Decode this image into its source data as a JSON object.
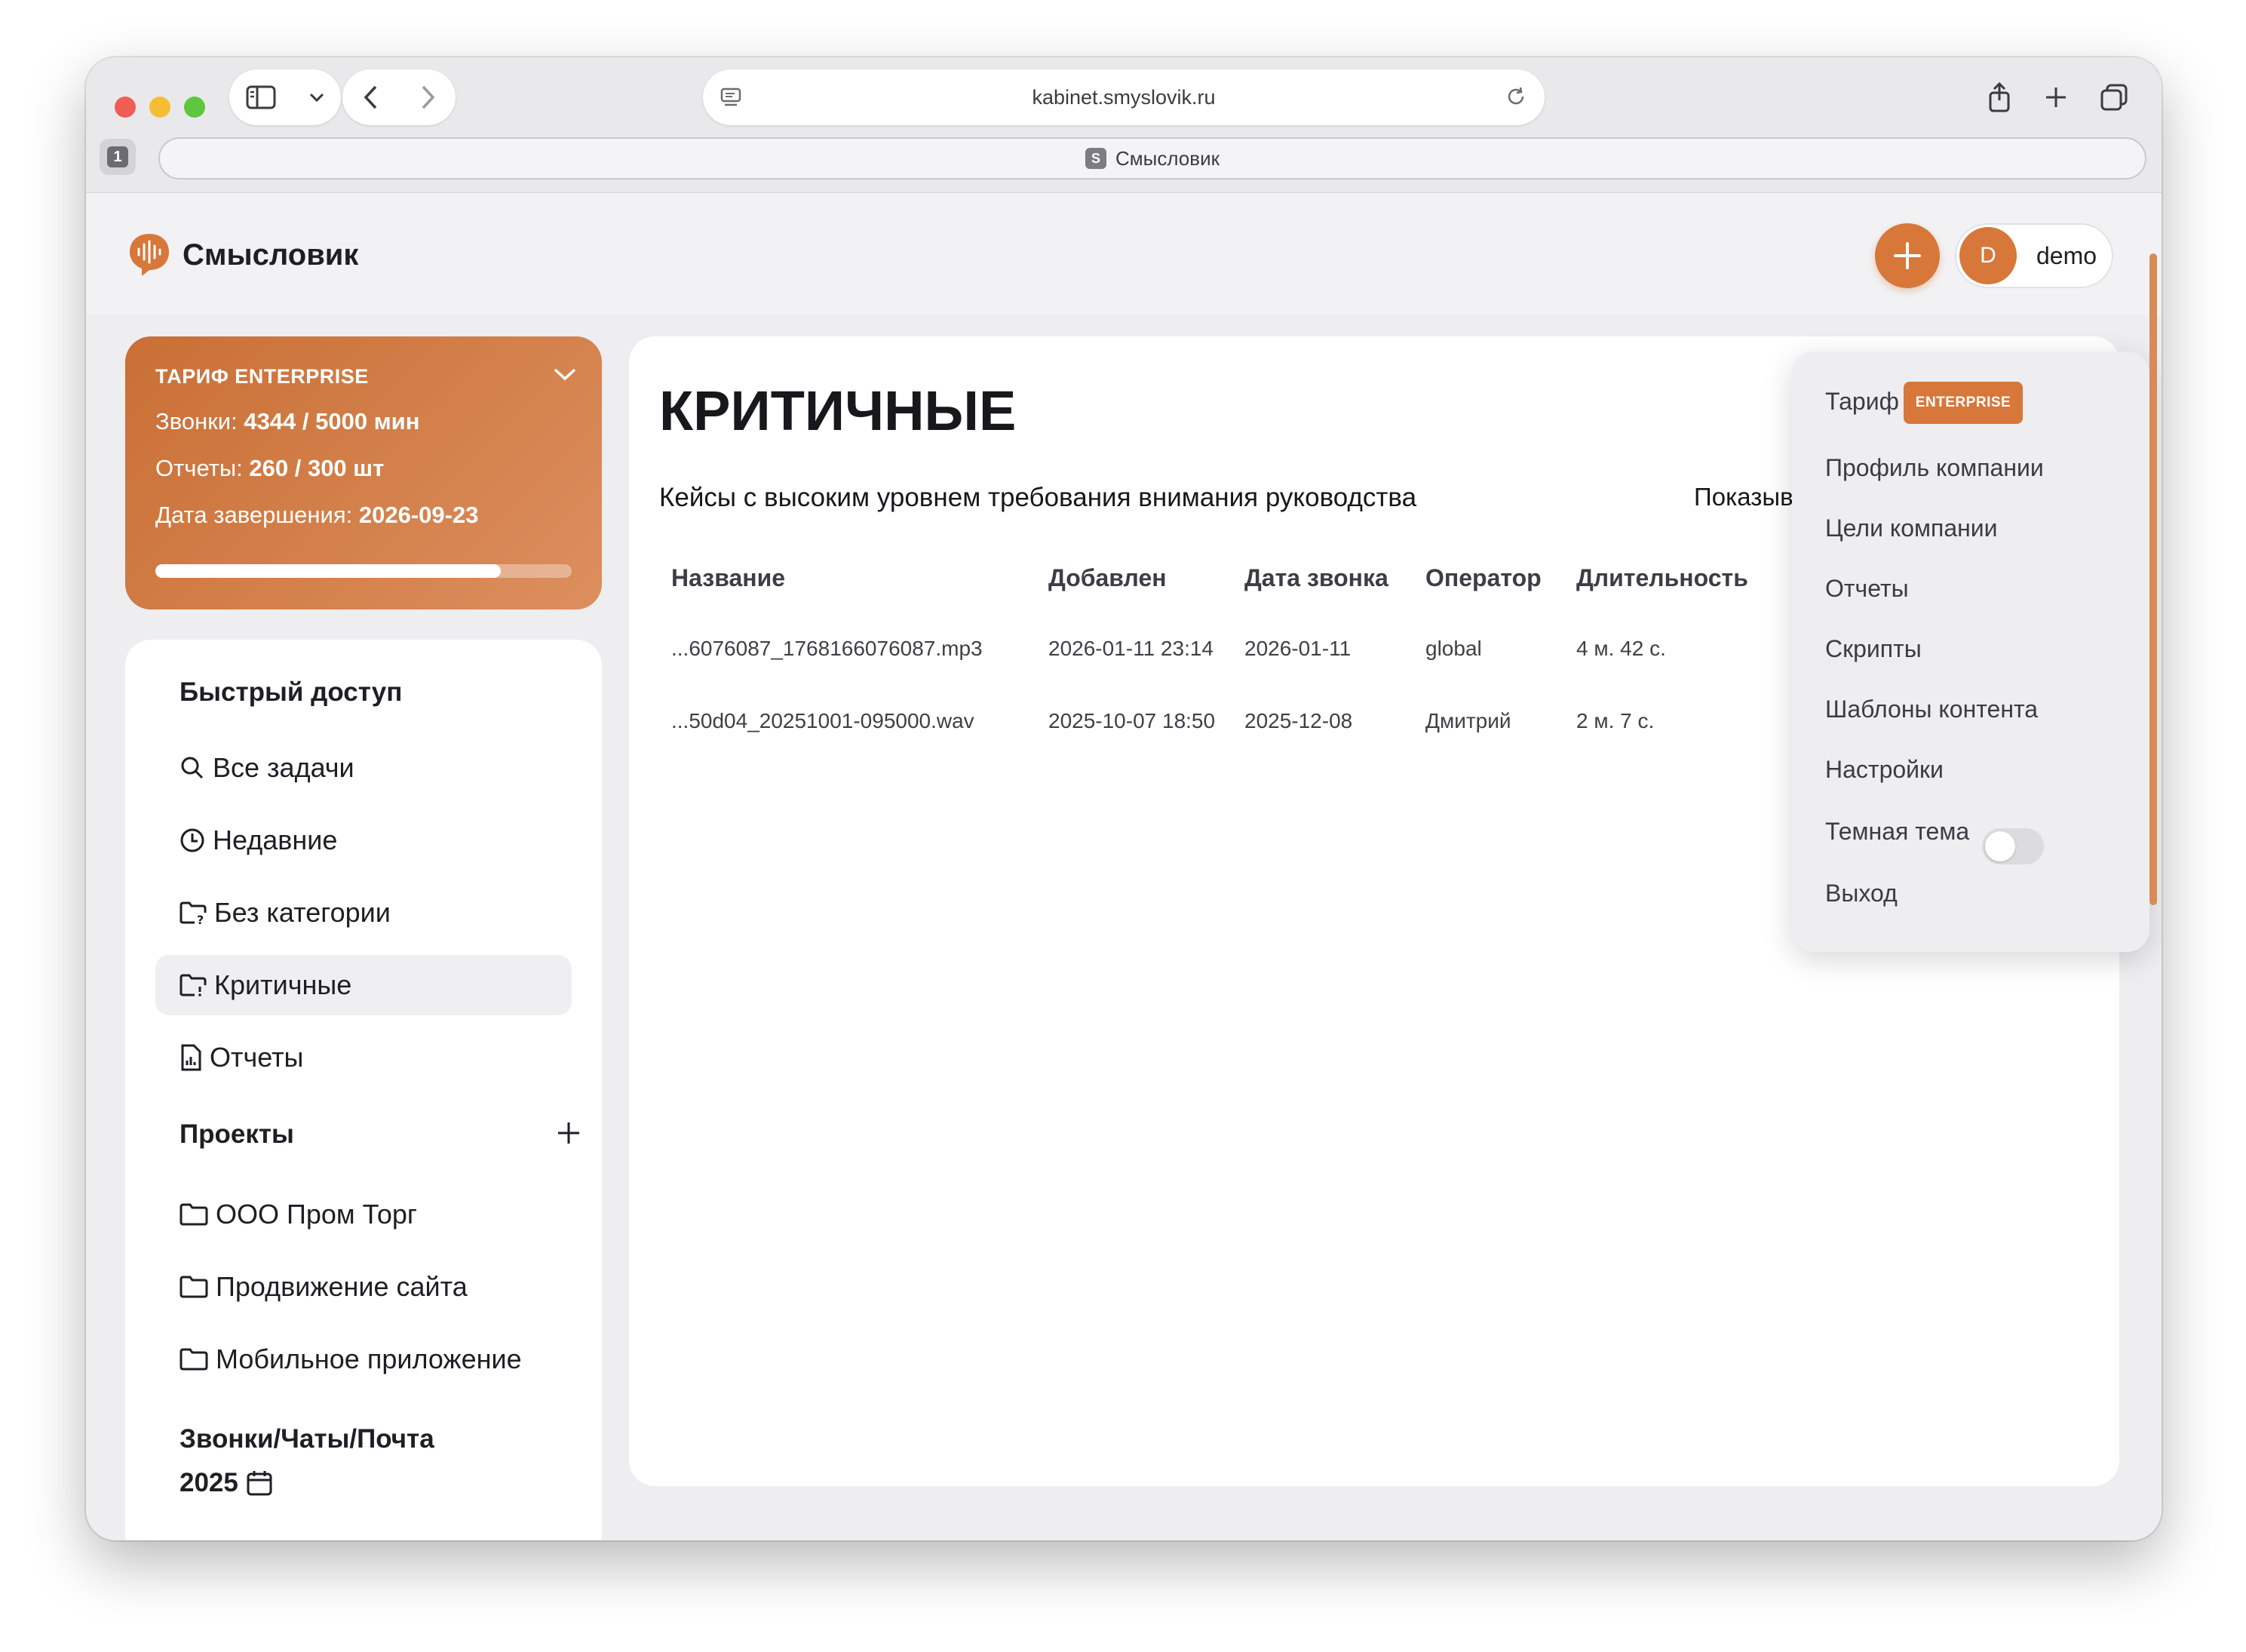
{
  "browser": {
    "url": "kabinet.smyslovik.ru",
    "tab_count": "1",
    "tab_favicon": "S",
    "tab_title": "Смысловик"
  },
  "app": {
    "logo_text": "Смысловик",
    "user_initial": "D",
    "user_name": "demo",
    "accent_color": "#d8773a"
  },
  "tariff": {
    "title": "ТАРИФ ENTERPRISE",
    "calls_label": "Звонки:",
    "calls_value": "4344 / 5000 мин",
    "reports_label": "Отчеты:",
    "reports_value": "260 / 300 шт",
    "end_label": "Дата завершения:",
    "end_value": "2026-09-23",
    "progress_fraction": 0.83
  },
  "sidebar": {
    "quick_access_title": "Быстрый доступ",
    "quick_items": [
      {
        "label": "Все задачи",
        "icon": "search-icon"
      },
      {
        "label": "Недавние",
        "icon": "clock-icon"
      },
      {
        "label": "Без категории",
        "icon": "folder-question-icon"
      },
      {
        "label": "Критичные",
        "icon": "folder-alert-icon"
      },
      {
        "label": "Отчеты",
        "icon": "report-icon"
      }
    ],
    "projects_title": "Проекты",
    "projects": [
      {
        "label": "ООО Пром Торг",
        "icon": "folder-icon"
      },
      {
        "label": "Продвижение сайта",
        "icon": "folder-icon"
      },
      {
        "label": "Мобильное приложение",
        "icon": "folder-icon"
      }
    ],
    "calls_section_title": "Звонки/Чаты/Почта",
    "year": "2025"
  },
  "main": {
    "title": "КРИТИЧНЫЕ",
    "subtitle": "Кейсы с высоким уровнем требования внимания руководства",
    "show_label": "Показыв",
    "columns": [
      "Название",
      "Добавлен",
      "Дата звонка",
      "Оператор",
      "Длительность"
    ],
    "rows": [
      [
        "...6076087_1768166076087.mp3",
        "2026-01-11 23:14",
        "2026-01-11",
        "global",
        "4 м. 42 с."
      ],
      [
        "...50d04_20251001-095000.wav",
        "2025-10-07 18:50",
        "2025-12-08",
        "Дмитрий",
        "2 м. 7 с."
      ]
    ]
  },
  "menu": {
    "tariff_label": "Тариф",
    "tariff_badge": "ENTERPRISE",
    "items": [
      "Профиль компании",
      "Цели компании",
      "Отчеты",
      "Скрипты",
      "Шаблоны контента",
      "Настройки"
    ],
    "dark_theme_label": "Темная тема",
    "dark_theme_on": false,
    "logout_label": "Выход"
  }
}
